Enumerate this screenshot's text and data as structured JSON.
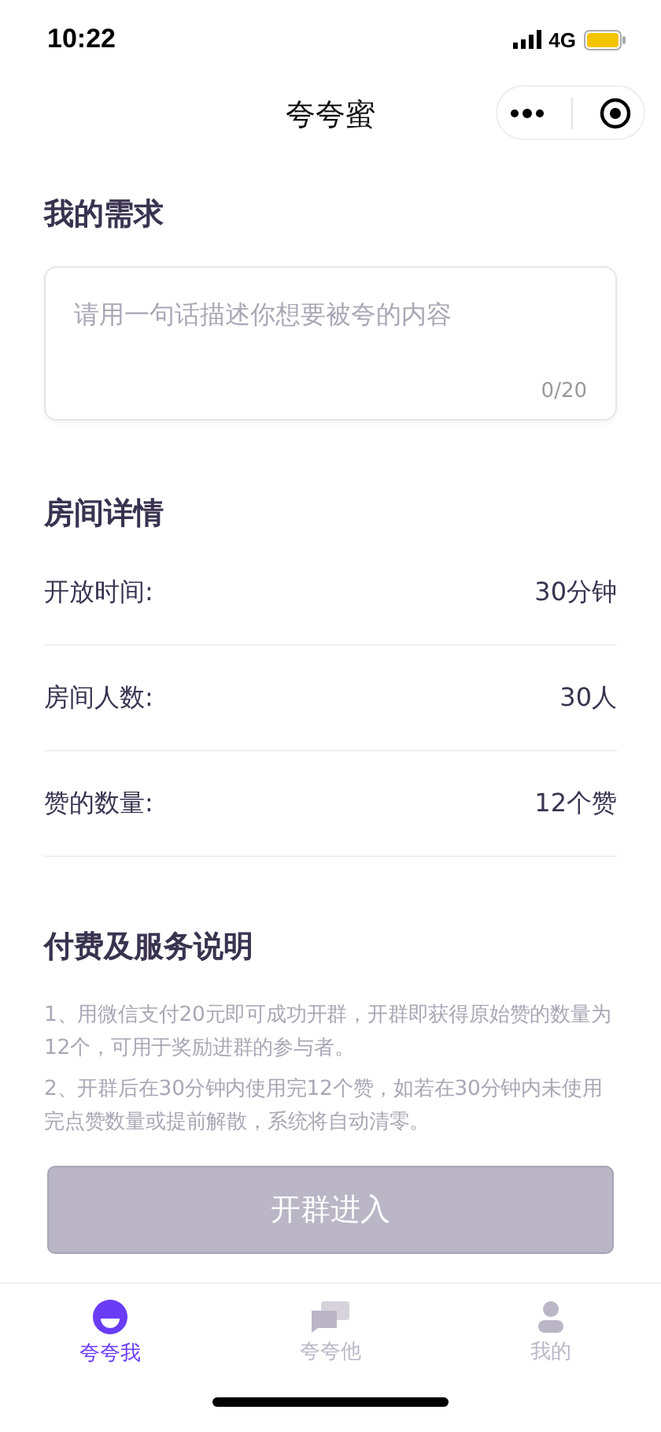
{
  "status_bar": {
    "time": "10:22",
    "network": "4G"
  },
  "nav": {
    "title": "夸夸蜜"
  },
  "request": {
    "title": "我的需求",
    "placeholder": "请用一句话描述你想要被夸的内容",
    "counter": "0/20"
  },
  "room": {
    "title": "房间详情",
    "rows": [
      {
        "label": "开放时间:",
        "value": "30分钟"
      },
      {
        "label": "房间人数:",
        "value": "30人"
      },
      {
        "label": "赞的数量:",
        "value": "12个赞"
      }
    ]
  },
  "payment": {
    "title": "付费及服务说明",
    "notes": [
      "1、用微信支付20元即可成功开群，开群即获得原始赞的数量为12个，可用于奖励进群的参与者。",
      "2、开群后在30分钟内使用完12个赞，如若在30分钟内未使用完点赞数量或提前解散，系统将自动清零。"
    ]
  },
  "submit": {
    "label": "开群进入",
    "disabled": true
  },
  "tabs": [
    {
      "label": "夸夸我",
      "selected": true
    },
    {
      "label": "夸夸他",
      "selected": false
    },
    {
      "label": "我的",
      "selected": false
    }
  ]
}
